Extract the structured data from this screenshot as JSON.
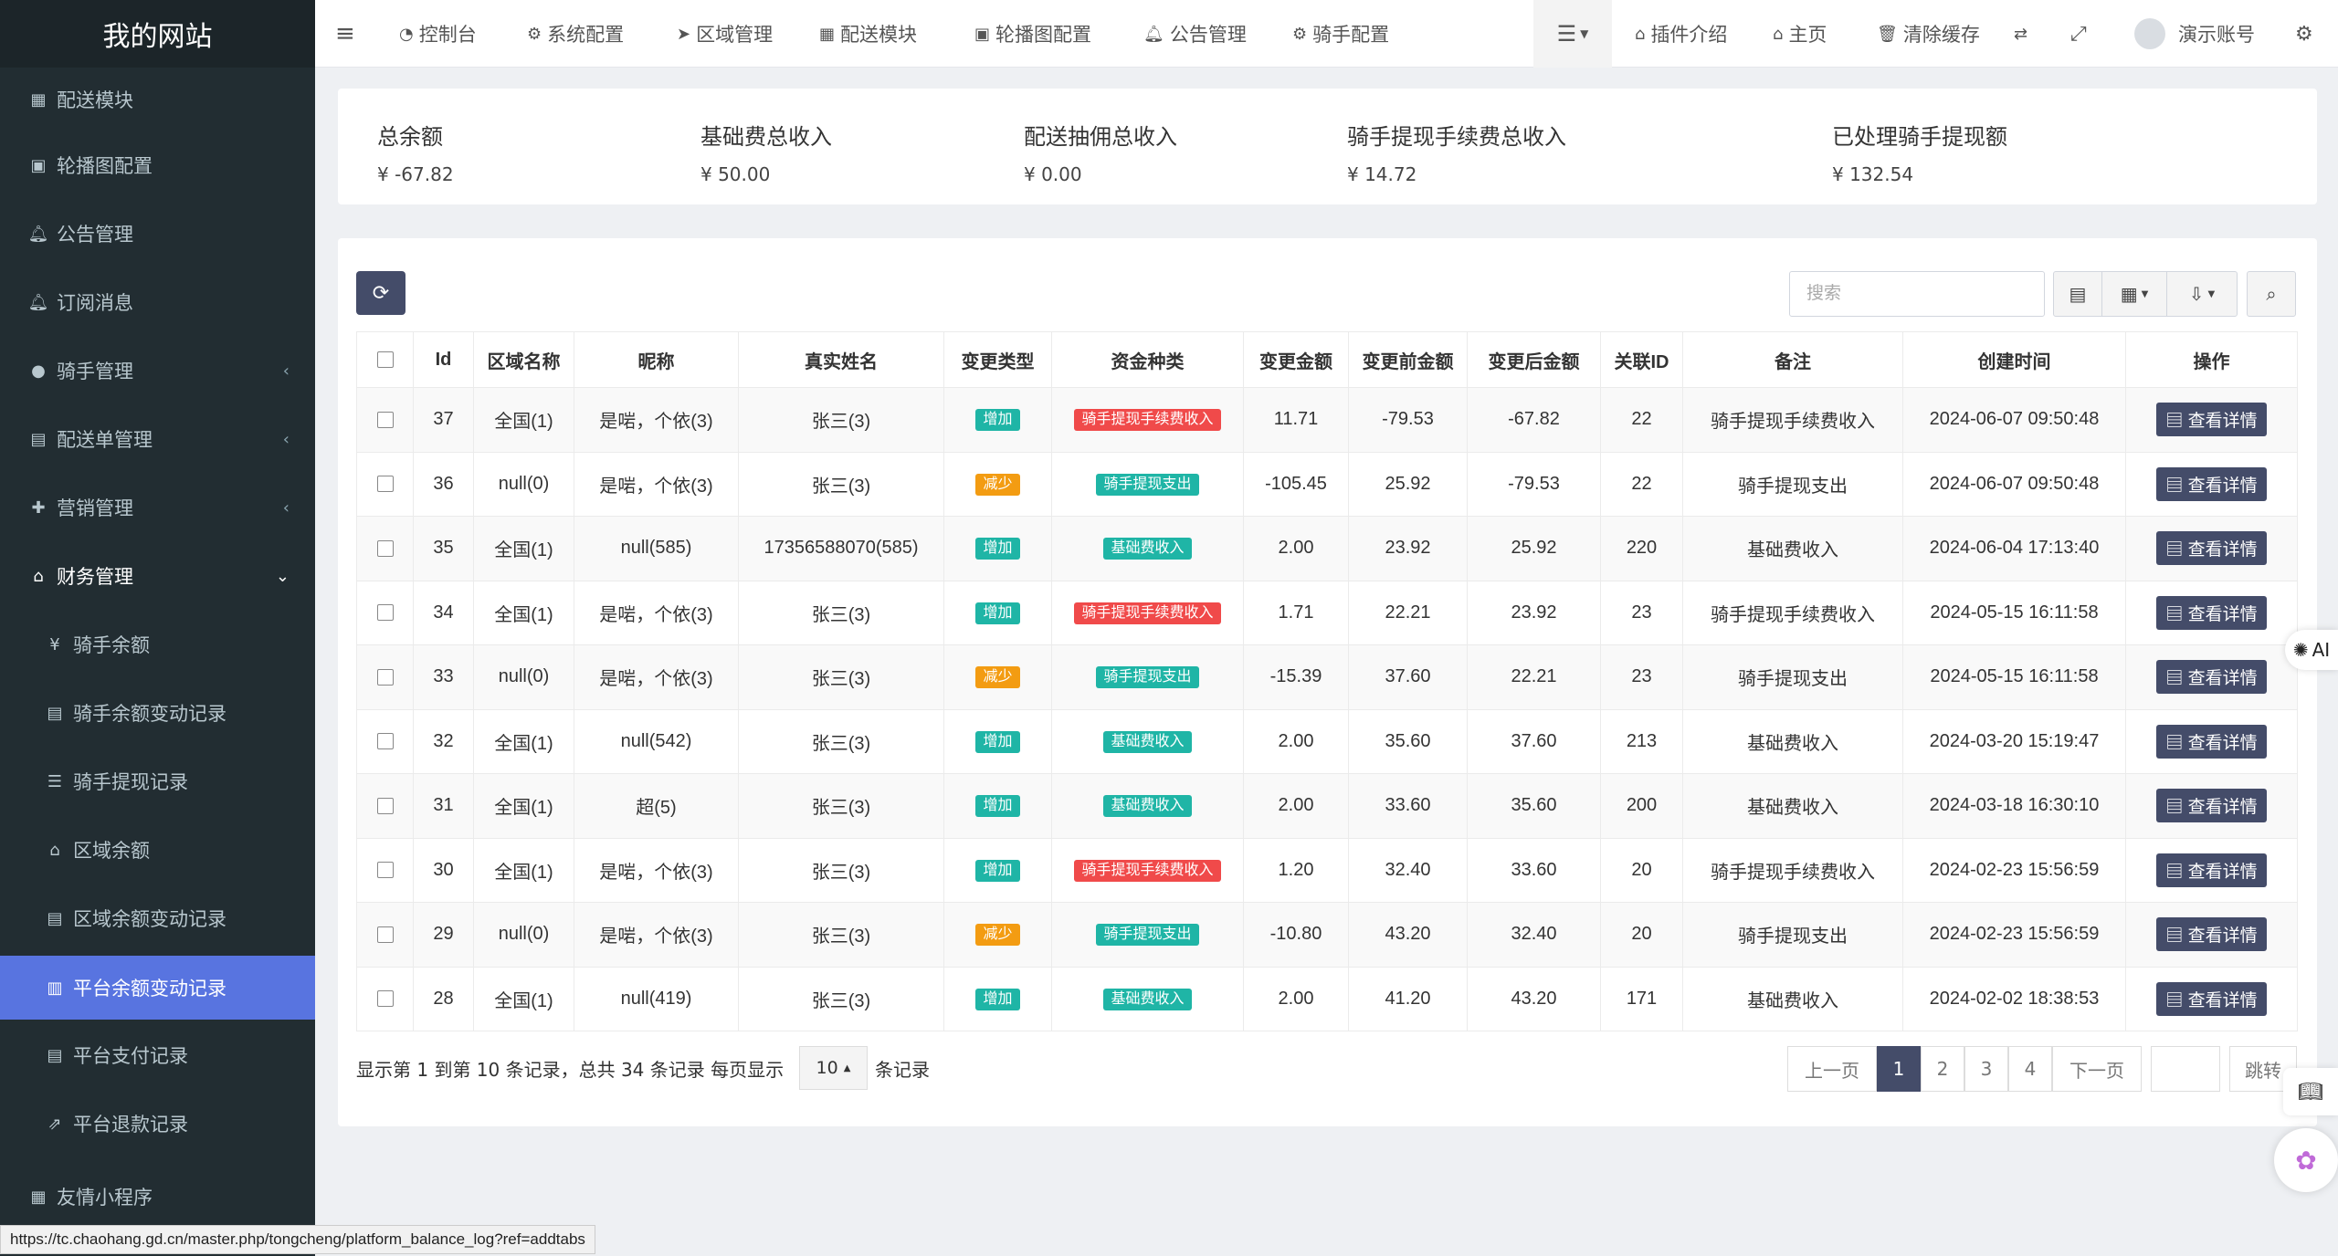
{
  "sidebar": {
    "logo": "我的网站",
    "items": [
      {
        "label": "配送模块",
        "icon": "th-icon"
      },
      {
        "label": "轮播图配置",
        "icon": "image-icon"
      },
      {
        "label": "公告管理",
        "icon": "bell-icon"
      },
      {
        "label": "订阅消息",
        "icon": "bell-icon"
      },
      {
        "label": "骑手管理",
        "icon": "user-circle-icon"
      },
      {
        "label": "配送单管理",
        "icon": "list-alt-icon"
      },
      {
        "label": "营销管理",
        "icon": "gift-icon"
      },
      {
        "label": "财务管理",
        "icon": "bank-icon"
      },
      {
        "label": "骑手余额",
        "icon": "yen-icon"
      },
      {
        "label": "骑手余额变动记录",
        "icon": "list-icon"
      },
      {
        "label": "骑手提现记录",
        "icon": "list-ol-icon"
      },
      {
        "label": "区域余额",
        "icon": "bank-icon"
      },
      {
        "label": "区域余额变动记录",
        "icon": "list-icon"
      },
      {
        "label": "平台余额变动记录",
        "icon": "bar-chart-icon"
      },
      {
        "label": "平台支付记录",
        "icon": "list-icon"
      },
      {
        "label": "平台退款记录",
        "icon": "share-square-icon"
      },
      {
        "label": "友情小程序",
        "icon": "th-icon"
      }
    ],
    "chevron_left": "‹",
    "chevron_down": "⌄"
  },
  "topbar": {
    "menu_icon": "≡",
    "nav": [
      "控制台",
      "系统配置",
      "区域管理",
      "配送模块",
      "轮播图配置",
      "公告管理",
      "骑手配置"
    ],
    "right": [
      "插件介绍",
      "主页",
      "清除缓存"
    ],
    "account": "演示账号"
  },
  "stats": [
    {
      "label": "总余额",
      "value": "¥ -67.82"
    },
    {
      "label": "基础费总收入",
      "value": "¥ 50.00"
    },
    {
      "label": "配送抽佣总收入",
      "value": "¥ 0.00"
    },
    {
      "label": "骑手提现手续费总收入",
      "value": "¥ 14.72"
    },
    {
      "label": "已处理骑手提现额",
      "value": "¥ 132.54"
    }
  ],
  "toolbar": {
    "search_placeholder": "搜索"
  },
  "table": {
    "headers": [
      "Id",
      "区域名称",
      "昵称",
      "真实姓名",
      "变更类型",
      "资金种类",
      "变更金额",
      "变更前金额",
      "变更后金额",
      "关联ID",
      "备注",
      "创建时间",
      "操作"
    ],
    "detail_label": "查看详情",
    "rows": [
      {
        "id": "37",
        "region": "全国(1)",
        "nick": "是啱，个依(3)",
        "real": "张三(3)",
        "type": "增加",
        "type_color": "#1fb5a6",
        "kind": "骑手提现手续费收入",
        "kind_color": "#f04a4a",
        "amount": "11.71",
        "before": "-79.53",
        "after": "-67.82",
        "rel": "22",
        "note": "骑手提现手续费收入",
        "time": "2024-06-07 09:50:48"
      },
      {
        "id": "36",
        "region": "null(0)",
        "nick": "是啱，个依(3)",
        "real": "张三(3)",
        "type": "减少",
        "type_color": "#f39c12",
        "kind": "骑手提现支出",
        "kind_color": "#1fb5a6",
        "amount": "-105.45",
        "before": "25.92",
        "after": "-79.53",
        "rel": "22",
        "note": "骑手提现支出",
        "time": "2024-06-07 09:50:48"
      },
      {
        "id": "35",
        "region": "全国(1)",
        "nick": "null(585)",
        "real": "17356588070(585)",
        "type": "增加",
        "type_color": "#1fb5a6",
        "kind": "基础费收入",
        "kind_color": "#1fb5a6",
        "amount": "2.00",
        "before": "23.92",
        "after": "25.92",
        "rel": "220",
        "note": "基础费收入",
        "time": "2024-06-04 17:13:40"
      },
      {
        "id": "34",
        "region": "全国(1)",
        "nick": "是啱，个依(3)",
        "real": "张三(3)",
        "type": "增加",
        "type_color": "#1fb5a6",
        "kind": "骑手提现手续费收入",
        "kind_color": "#f04a4a",
        "amount": "1.71",
        "before": "22.21",
        "after": "23.92",
        "rel": "23",
        "note": "骑手提现手续费收入",
        "time": "2024-05-15 16:11:58"
      },
      {
        "id": "33",
        "region": "null(0)",
        "nick": "是啱，个依(3)",
        "real": "张三(3)",
        "type": "减少",
        "type_color": "#f39c12",
        "kind": "骑手提现支出",
        "kind_color": "#1fb5a6",
        "amount": "-15.39",
        "before": "37.60",
        "after": "22.21",
        "rel": "23",
        "note": "骑手提现支出",
        "time": "2024-05-15 16:11:58"
      },
      {
        "id": "32",
        "region": "全国(1)",
        "nick": "null(542)",
        "real": "张三(3)",
        "type": "增加",
        "type_color": "#1fb5a6",
        "kind": "基础费收入",
        "kind_color": "#1fb5a6",
        "amount": "2.00",
        "before": "35.60",
        "after": "37.60",
        "rel": "213",
        "note": "基础费收入",
        "time": "2024-03-20 15:19:47"
      },
      {
        "id": "31",
        "region": "全国(1)",
        "nick": "超(5)",
        "real": "张三(3)",
        "type": "增加",
        "type_color": "#1fb5a6",
        "kind": "基础费收入",
        "kind_color": "#1fb5a6",
        "amount": "2.00",
        "before": "33.60",
        "after": "35.60",
        "rel": "200",
        "note": "基础费收入",
        "time": "2024-03-18 16:30:10"
      },
      {
        "id": "30",
        "region": "全国(1)",
        "nick": "是啱，个依(3)",
        "real": "张三(3)",
        "type": "增加",
        "type_color": "#1fb5a6",
        "kind": "骑手提现手续费收入",
        "kind_color": "#f04a4a",
        "amount": "1.20",
        "before": "32.40",
        "after": "33.60",
        "rel": "20",
        "note": "骑手提现手续费收入",
        "time": "2024-02-23 15:56:59"
      },
      {
        "id": "29",
        "region": "null(0)",
        "nick": "是啱，个依(3)",
        "real": "张三(3)",
        "type": "减少",
        "type_color": "#f39c12",
        "kind": "骑手提现支出",
        "kind_color": "#1fb5a6",
        "amount": "-10.80",
        "before": "43.20",
        "after": "32.40",
        "rel": "20",
        "note": "骑手提现支出",
        "time": "2024-02-23 15:56:59"
      },
      {
        "id": "28",
        "region": "全国(1)",
        "nick": "null(419)",
        "real": "张三(3)",
        "type": "增加",
        "type_color": "#1fb5a6",
        "kind": "基础费收入",
        "kind_color": "#1fb5a6",
        "amount": "2.00",
        "before": "41.20",
        "after": "43.20",
        "rel": "171",
        "note": "基础费收入",
        "time": "2024-02-02 18:38:53"
      }
    ]
  },
  "footer": {
    "summary": "显示第 1 到第 10 条记录，总共 34 条记录 每页显示",
    "page_size": "10",
    "records_suffix": "条记录",
    "prev": "上一页",
    "pages": [
      "1",
      "2",
      "3",
      "4"
    ],
    "next": "下一页",
    "jump": "跳转"
  },
  "floating": {
    "ai_label": "AI"
  },
  "status_url": "https://tc.chaohang.gd.cn/master.php/tongcheng/platform_balance_log?ref=addtabs"
}
